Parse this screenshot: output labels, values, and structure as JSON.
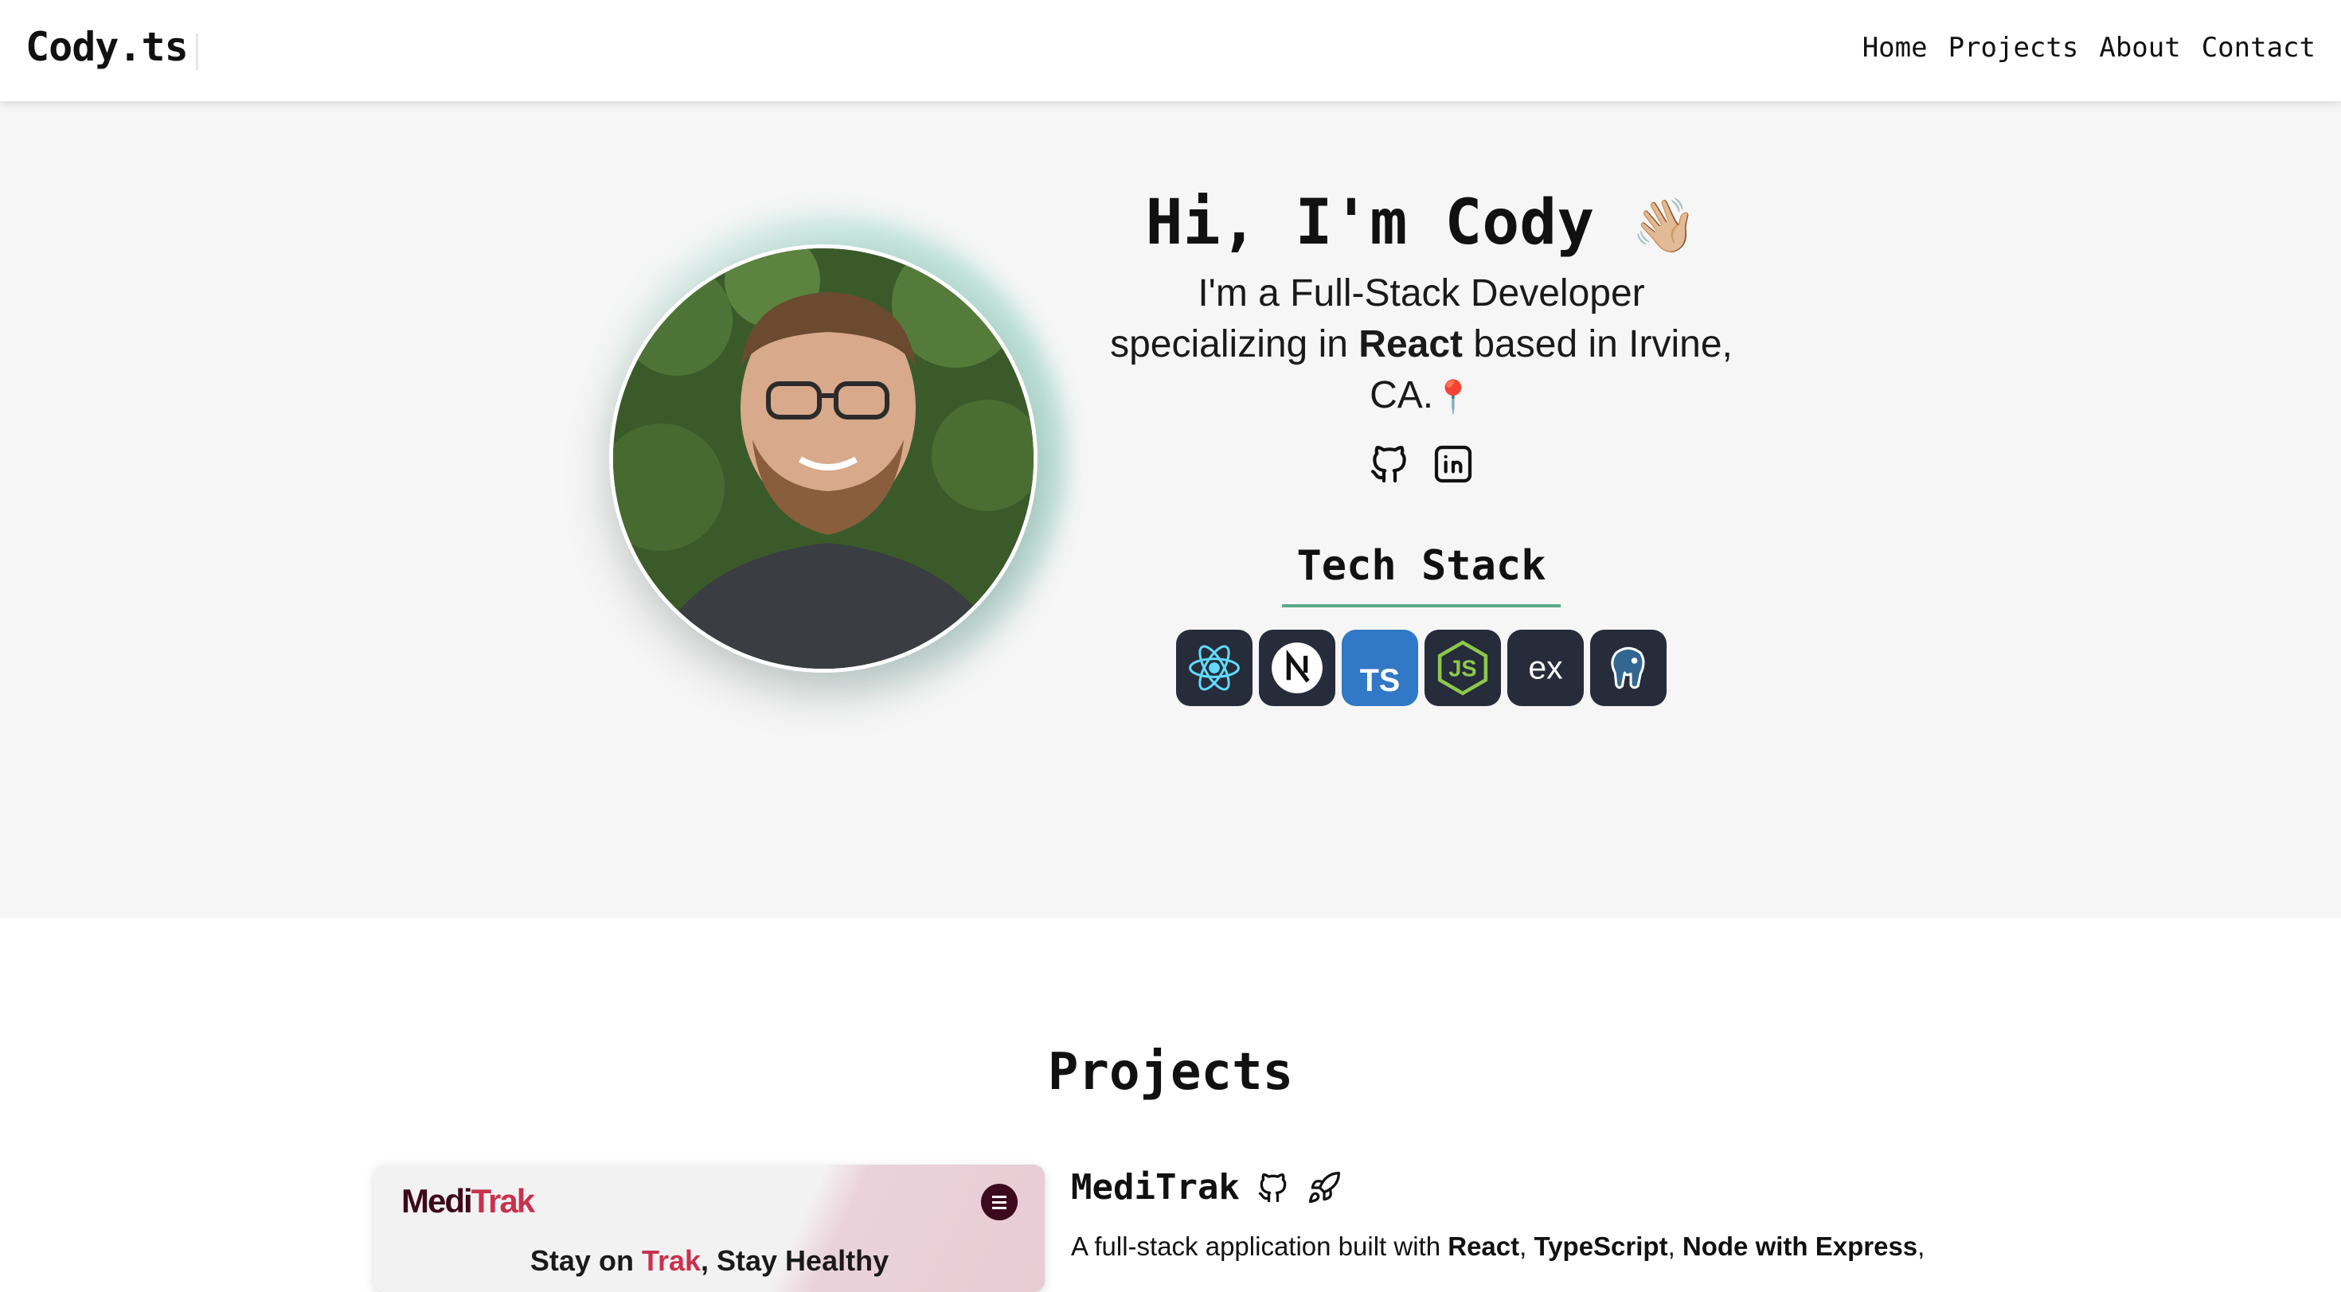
{
  "header": {
    "logo": "Cody.ts",
    "nav": [
      "Home",
      "Projects",
      "About",
      "Contact"
    ]
  },
  "hero": {
    "greeting": "Hi, I'm Cody",
    "wave_emoji": "👋🏼",
    "bio_part1": "I'm a Full-Stack Developer specializing in ",
    "bio_bold": "React",
    "bio_part2": " based in Irvine, CA.",
    "pin_emoji": "📍",
    "socials": [
      "github-icon",
      "linkedin-icon"
    ],
    "tech_stack_title": "Tech Stack",
    "tech_stack": [
      "React",
      "Next.js",
      "TypeScript",
      "Node.js",
      "Express",
      "PostgreSQL"
    ]
  },
  "projects": {
    "title": "Projects",
    "items": [
      {
        "name": "MediTrak",
        "card_logo_a": "Medi",
        "card_logo_b": "Trak",
        "card_tagline_a": "Stay on ",
        "card_tagline_b": "Trak",
        "card_tagline_c": ", Stay Healthy",
        "desc_prefix": "A full-stack application built with ",
        "desc_tech1": "React",
        "desc_sep1": ", ",
        "desc_tech2": "TypeScript",
        "desc_sep2": ", ",
        "desc_tech3": "Node with Express",
        "desc_sep3": ","
      }
    ]
  },
  "colors": {
    "accent": "#5aa98a",
    "brand_dark": "#3c0a1c",
    "brand_red": "#c8324d",
    "ts_blue": "#3178c6",
    "tile_dark": "#262c3a"
  }
}
